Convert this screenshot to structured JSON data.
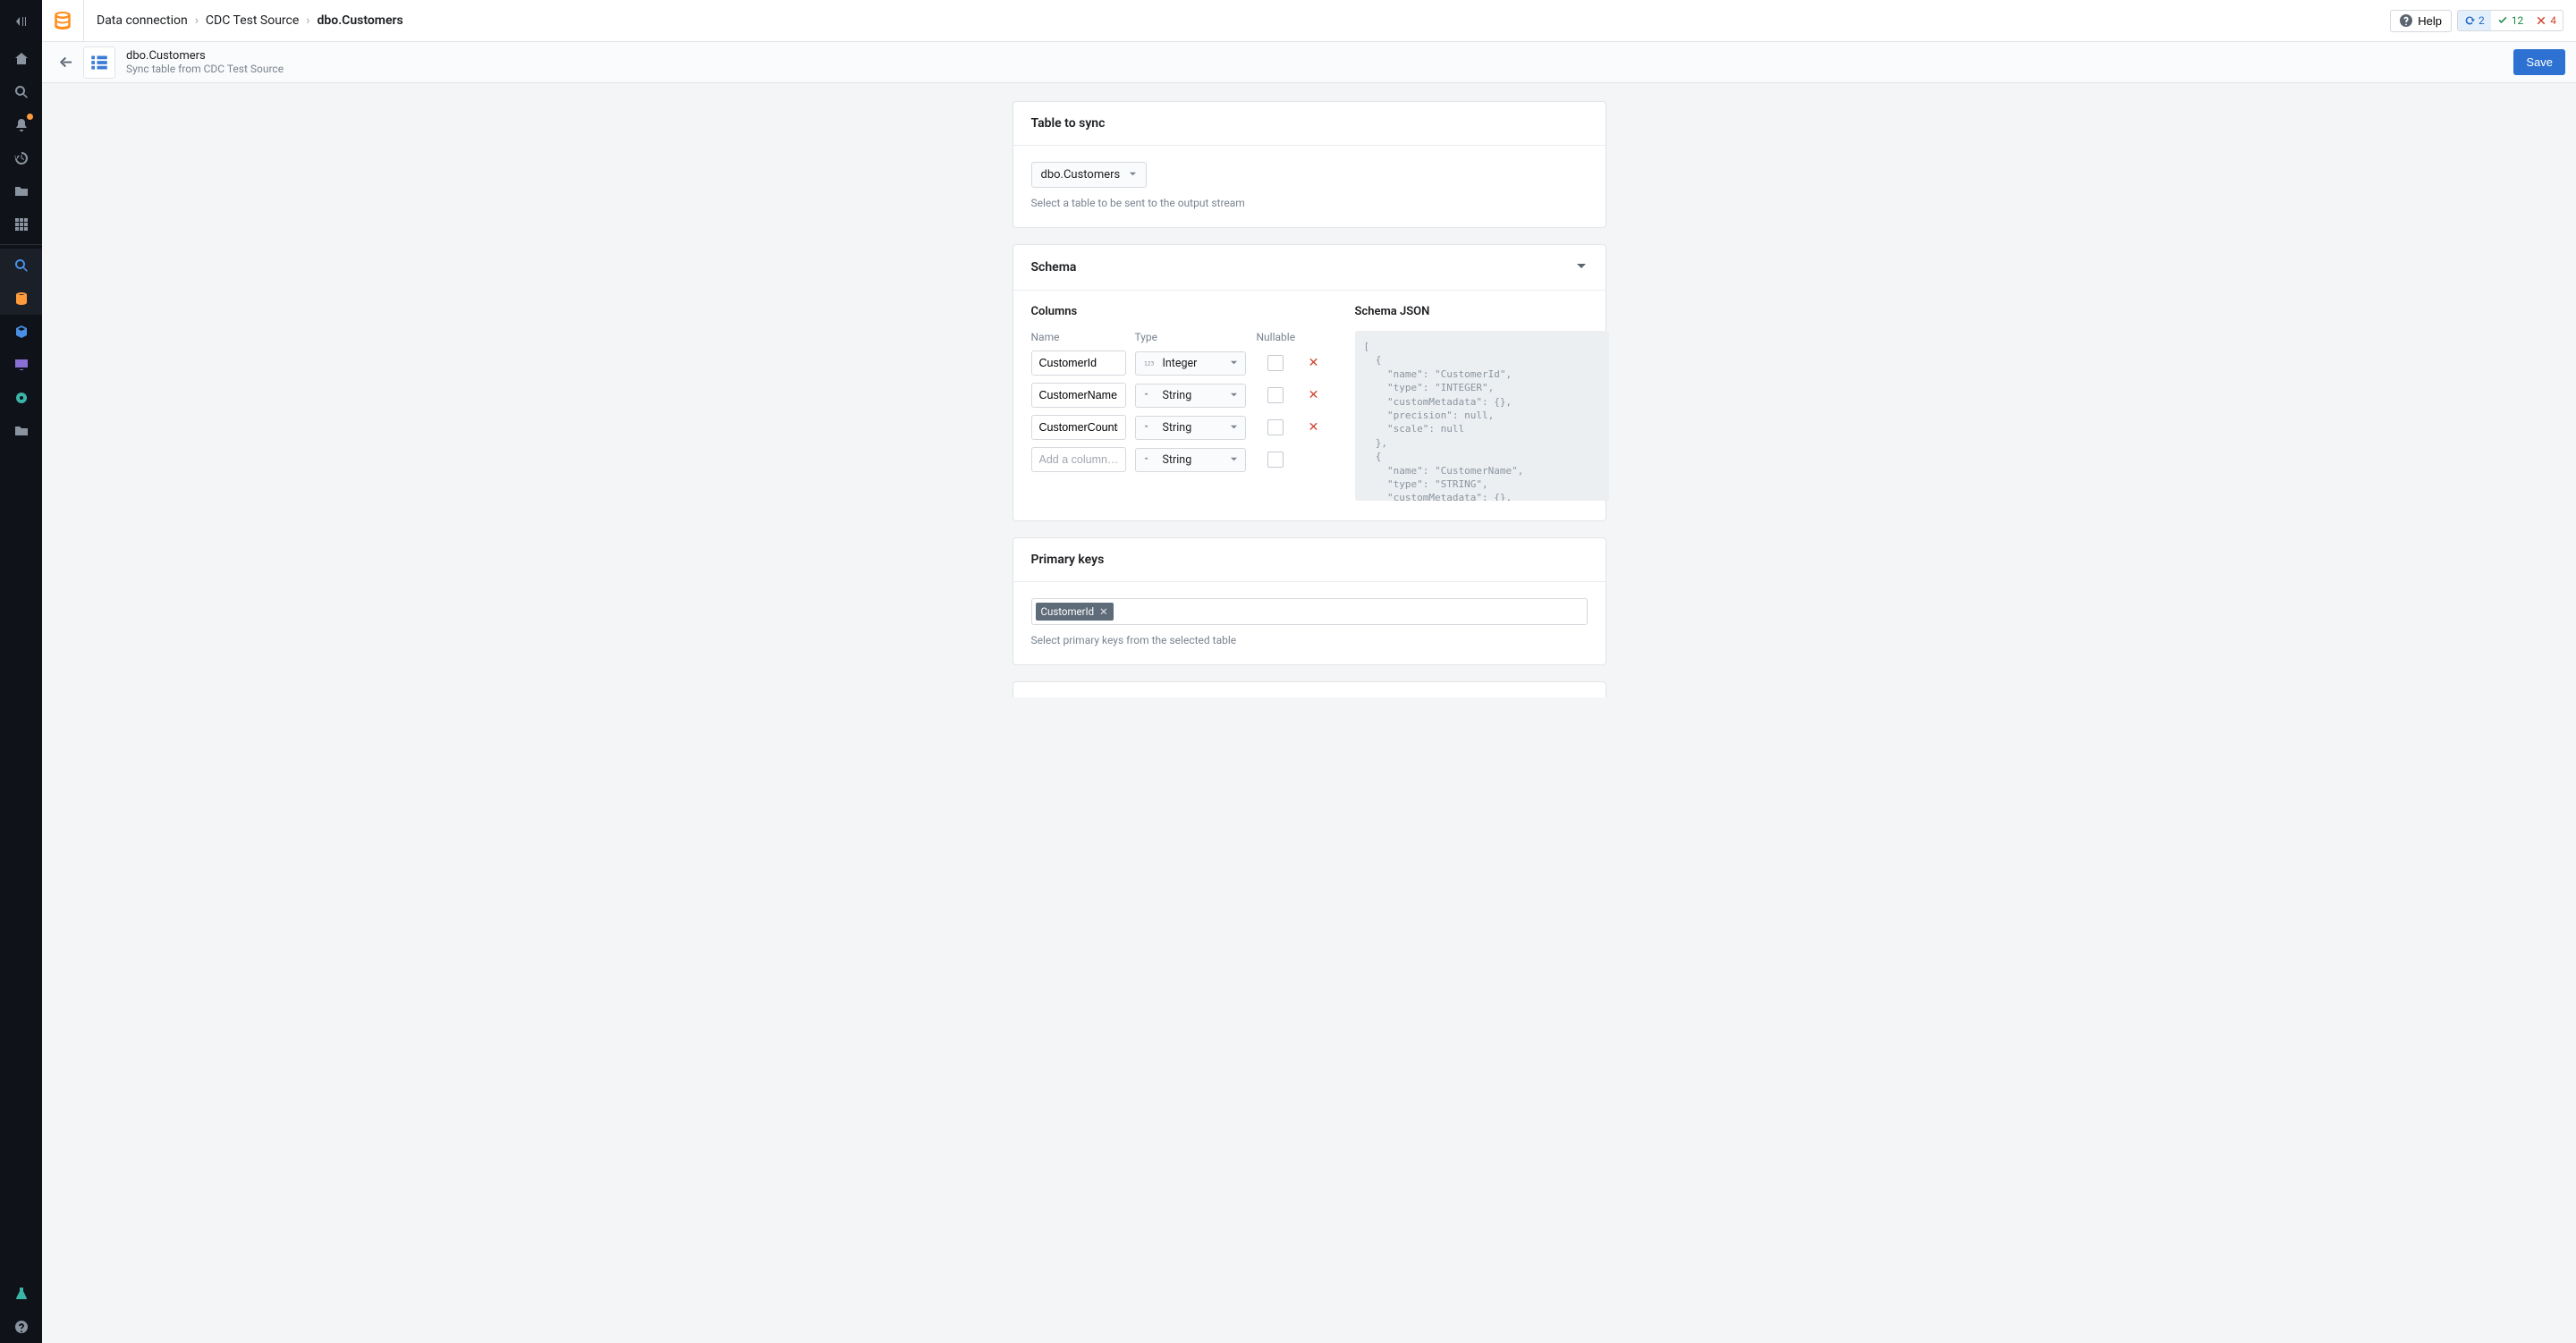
{
  "breadcrumb": {
    "root": "Data connection",
    "source": "CDC Test Source",
    "current": "dbo.Customers"
  },
  "topbar": {
    "help": "Help",
    "status": {
      "refresh": "2",
      "ok": "12",
      "err": "4"
    }
  },
  "subbar": {
    "title": "dbo.Customers",
    "subtitle": "Sync table from CDC Test Source",
    "save": "Save"
  },
  "sections": {
    "table_to_sync": {
      "title": "Table to sync",
      "selected": "dbo.Customers",
      "helper": "Select a table to be sent to the output stream"
    },
    "schema": {
      "title": "Schema",
      "columns_label": "Columns",
      "json_label": "Schema JSON",
      "headers": {
        "name": "Name",
        "type": "Type",
        "nullable": "Nullable"
      },
      "columns": [
        {
          "name": "CustomerId",
          "type": "Integer",
          "type_icon": "int"
        },
        {
          "name": "CustomerName",
          "type": "String",
          "type_icon": "str"
        },
        {
          "name": "CustomerCountry",
          "type": "String",
          "type_icon": "str"
        }
      ],
      "add_placeholder": "Add a column…",
      "add_type": "String",
      "json_text": "[\n  {\n    \"name\": \"CustomerId\",\n    \"type\": \"INTEGER\",\n    \"customMetadata\": {},\n    \"precision\": null,\n    \"scale\": null\n  },\n  {\n    \"name\": \"CustomerName\",\n    \"type\": \"STRING\",\n    \"customMetadata\": {},\n    \"precision\": null,"
    },
    "primary_keys": {
      "title": "Primary keys",
      "tags": [
        "CustomerId"
      ],
      "helper": "Select primary keys from the selected table"
    }
  }
}
